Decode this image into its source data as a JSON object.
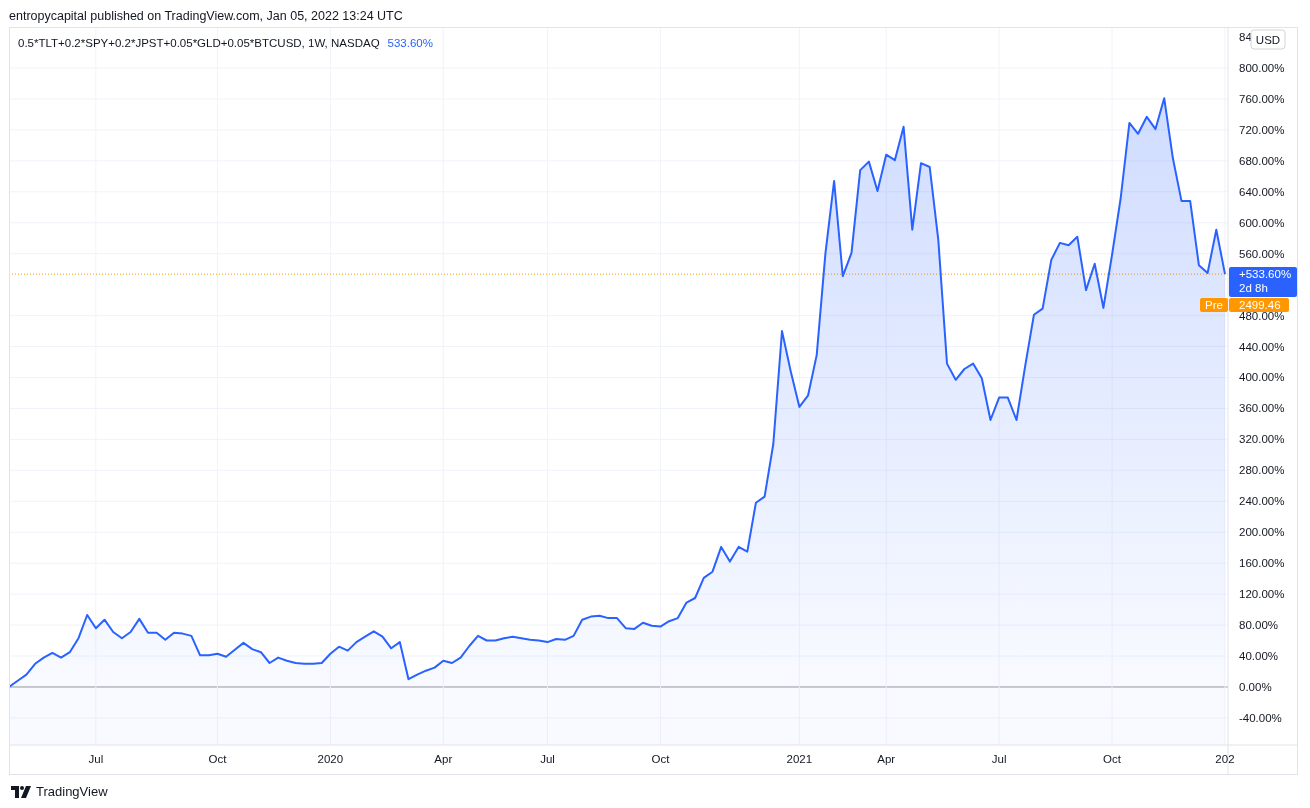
{
  "header": {
    "text": "entropycapital published on TradingView.com, Jan 05, 2022 13:24 UTC"
  },
  "chart": {
    "legend": "0.5*TLT+0.2*SPY+0.2*JPST+0.05*GLD+0.05*BTCUSD, 1W, NASDAQ",
    "legend_value": "533.60%",
    "axis_cut_label": "84",
    "currency": "USD",
    "last_label": {
      "countdown": "2d 8h"
    },
    "pre_label": {
      "tag": "Pre",
      "value": "2499.46"
    },
    "chart_data": {
      "type": "area",
      "grid": true,
      "ylim": [
        -75,
        853
      ],
      "categories": [
        null,
        null,
        null,
        null,
        null,
        null,
        null,
        null,
        null,
        null,
        "Jul",
        null,
        null,
        null,
        null,
        null,
        null,
        null,
        null,
        null,
        null,
        null,
        null,
        null,
        "Oct",
        null,
        null,
        null,
        null,
        null,
        null,
        null,
        null,
        null,
        null,
        null,
        null,
        "2020",
        null,
        null,
        null,
        null,
        null,
        null,
        null,
        null,
        null,
        null,
        null,
        null,
        "Apr",
        null,
        null,
        null,
        null,
        null,
        null,
        null,
        null,
        null,
        null,
        null,
        "Jul",
        null,
        null,
        null,
        null,
        null,
        null,
        null,
        null,
        null,
        null,
        null,
        null,
        "Oct",
        null,
        null,
        null,
        null,
        null,
        null,
        null,
        null,
        null,
        null,
        null,
        null,
        null,
        null,
        null,
        "2021",
        null,
        null,
        null,
        null,
        null,
        null,
        null,
        null,
        null,
        "Apr",
        null,
        null,
        null,
        null,
        null,
        null,
        null,
        null,
        null,
        null,
        null,
        null,
        "Jul",
        null,
        null,
        null,
        null,
        null,
        null,
        null,
        null,
        null,
        null,
        null,
        null,
        "Oct",
        null,
        null,
        null,
        null,
        null,
        null,
        null,
        null,
        null,
        null,
        null,
        null,
        "202"
      ],
      "series": [
        {
          "color": "#2962ff",
          "values": [
            0,
            8,
            16,
            30,
            38,
            44,
            38,
            45,
            63,
            93,
            76,
            87,
            71,
            63,
            71,
            88,
            70,
            70,
            61,
            70,
            69,
            66,
            41,
            41,
            43,
            39,
            48,
            57,
            49,
            45,
            31,
            38,
            34,
            31,
            30,
            30,
            31,
            43,
            52,
            47,
            58,
            65,
            72,
            65,
            50,
            58,
            10,
            16,
            21,
            25,
            34,
            31,
            38,
            53,
            66,
            60,
            60,
            63,
            65,
            63,
            61,
            60,
            58,
            62,
            61,
            66,
            87,
            91,
            92,
            89,
            89,
            76,
            75,
            83,
            79,
            78,
            85,
            89,
            109,
            115,
            141,
            149,
            181,
            162,
            181,
            175,
            238,
            246,
            314,
            460,
            408,
            362,
            377,
            429,
            560,
            654,
            531,
            561,
            668,
            679,
            641,
            688,
            681,
            724,
            591,
            677,
            672,
            578,
            418,
            397,
            411,
            418,
            399,
            345,
            374,
            374,
            345,
            415,
            481,
            489,
            552,
            574,
            571,
            582,
            513,
            547,
            490,
            558,
            632,
            729,
            715,
            737,
            721,
            761,
            684,
            628,
            628,
            545,
            535,
            591,
            533.6
          ]
        }
      ],
      "ref_lines": [
        {
          "axis": "y",
          "value": 533.6,
          "color": "#ff9800",
          "label": "+533.60%"
        }
      ],
      "yticks": [
        {
          "value": -40,
          "label": "-40.00%"
        },
        {
          "value": 0,
          "label": "0.00%"
        },
        {
          "value": 40,
          "label": "40.00%"
        },
        {
          "value": 80,
          "label": "80.00%"
        },
        {
          "value": 120,
          "label": "120.00%"
        },
        {
          "value": 160,
          "label": "160.00%"
        },
        {
          "value": 200,
          "label": "200.00%"
        },
        {
          "value": 240,
          "label": "240.00%"
        },
        {
          "value": 280,
          "label": "280.00%"
        },
        {
          "value": 320,
          "label": "320.00%"
        },
        {
          "value": 360,
          "label": "360.00%"
        },
        {
          "value": 400,
          "label": "400.00%"
        },
        {
          "value": 440,
          "label": "440.00%"
        },
        {
          "value": 480,
          "label": "480.00%"
        },
        {
          "value": 560,
          "label": "560.00%"
        },
        {
          "value": 600,
          "label": "600.00%"
        },
        {
          "value": 640,
          "label": "640.00%"
        },
        {
          "value": 680,
          "label": "680.00%"
        },
        {
          "value": 720,
          "label": "720.00%"
        },
        {
          "value": 760,
          "label": "760.00%"
        },
        {
          "value": 800,
          "label": "800.00%"
        }
      ]
    }
  },
  "footer": {
    "logo_text": "TradingView"
  }
}
